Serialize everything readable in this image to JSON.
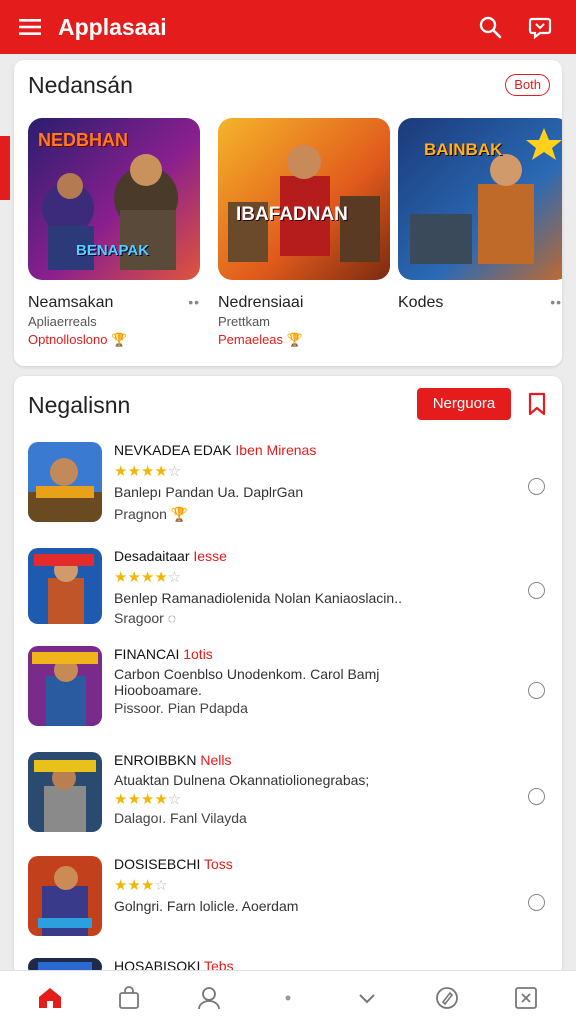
{
  "app": {
    "title": "Applasaai"
  },
  "colors": {
    "accent": "#e41c1c",
    "star": "#f2b705"
  },
  "featured": {
    "title": "Nedansán",
    "pill": "Both",
    "items": [
      {
        "name": "Neamsakan",
        "more": "••",
        "subtitle": "Apliaerreals",
        "tag": "Optnolloslono 🏆",
        "art_text": "NEDBHAN",
        "art_text2": "BENAPAK"
      },
      {
        "name": "Nedrensiaai",
        "more": "",
        "subtitle": "Prettkam",
        "tag": "Pemaeleas 🏆",
        "art_text": "IBAFADNAN"
      },
      {
        "name": "Kodes",
        "more": "••",
        "subtitle": "",
        "tag": "",
        "art_text": "BAINBAK"
      }
    ]
  },
  "list": {
    "title": "Negalisnn",
    "cta": "Nerguora",
    "rows": [
      {
        "title": "NEVKADEA EDAK",
        "title_red": "Iben Mirenas",
        "stars": "★★★★",
        "stars_off": "☆",
        "desc": "Banlepı Pandan Ua. DaplrGan",
        "desc2": "",
        "meta": "Pragnon 🏆"
      },
      {
        "title": "Desadaitaar",
        "title_red": "Iesse",
        "stars": "★★★★",
        "stars_off": "☆",
        "desc": "Benlep Ramanadiolenida Nolan Kaniaoslacin..",
        "desc2": "",
        "meta": "Sragoor ◌"
      },
      {
        "title": "FINANCAI",
        "title_red": "1otis",
        "stars": "",
        "stars_off": "",
        "desc": "Carbon Coenblso Unodenkom. Carol Bamj",
        "desc2": "Hiooboamare.",
        "meta": "Pissoor. Pian Pdapda"
      },
      {
        "title": "ENROIBBKN",
        "title_red": "Nells",
        "stars": "",
        "stars_off": "",
        "desc": "Atuaktan Dulnena Okannatiolionegrabas;",
        "desc2": "",
        "meta": "Dalagoı. Fanl Vilayda",
        "stars_below": "★★★★",
        "stars_below_off": "☆"
      },
      {
        "title": "DOSISEBCHI",
        "title_red": "Toss",
        "stars": "★★★",
        "stars_off": "☆",
        "desc": "Golngri. Farn lolicle. Aoerdam",
        "desc2": "",
        "meta": ""
      },
      {
        "title": "HOSABISOKI",
        "title_red": "Tebs",
        "stars": "",
        "stars_off": "",
        "desc": "",
        "desc2": "",
        "meta": ""
      }
    ]
  },
  "nav": {
    "items": [
      "home-icon",
      "shop-icon",
      "profile-icon",
      "dot-icon",
      "chevron-down-icon",
      "edit-icon",
      "close-box-icon"
    ]
  }
}
